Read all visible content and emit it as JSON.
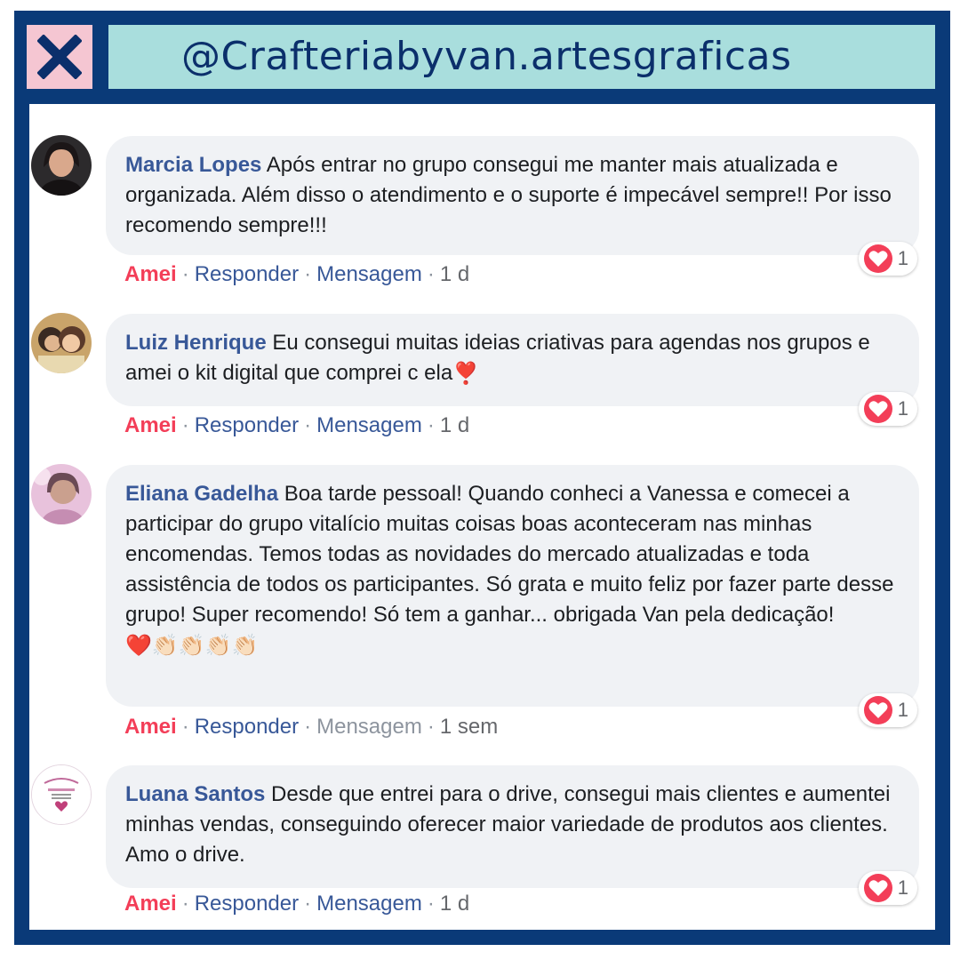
{
  "header": {
    "handle": "@Crafteriabyvan.artesgraficas",
    "close_icon": "close-x-icon",
    "colors": {
      "frame": "#0a3a78",
      "handle_bg": "#a9dedd",
      "close_bg": "#f5c6d2",
      "text": "#0b2f6b"
    }
  },
  "comments": [
    {
      "author": "Marcia Lopes",
      "text": "Após entrar no grupo consegui me manter mais atualizada e organizada. Além disso o atendimento e o suporte é impecável sempre!! Por isso recomendo sempre!!!",
      "actions": {
        "love": "Amei",
        "reply": "Responder",
        "message": "Mensagem",
        "time": "1 d"
      },
      "reaction_count": "1"
    },
    {
      "author": "Luiz Henrique",
      "text": "Eu consegui muitas ideias criativas para agendas nos grupos e amei o kit digital que comprei c ela",
      "emoji": "❣️",
      "actions": {
        "love": "Amei",
        "reply": "Responder",
        "message": "Mensagem",
        "time": "1 d"
      },
      "reaction_count": "1"
    },
    {
      "author": "Eliana Gadelha",
      "text": "Boa tarde pessoal! Quando conheci a Vanessa e comecei a participar do grupo vitalício muitas coisas boas aconteceram nas minhas encomendas. Temos todas as novidades do mercado atualizadas e toda assistência de todos os participantes. Só grata e muito feliz por fazer parte desse grupo! Super recomendo! Só tem a ganhar... obrigada Van pela dedicação!",
      "emoji": "❤️👏🏻👏🏻👏🏻👏🏻",
      "actions": {
        "love": "Amei",
        "reply": "Responder",
        "message": "Mensagem",
        "time": "1 sem"
      },
      "reaction_count": "1"
    },
    {
      "author": "Luana Santos",
      "text": "Desde que entrei para o drive, consegui mais clientes e aumentei minhas vendas, conseguindo oferecer maior variedade de produtos aos clientes. Amo o drive.",
      "actions": {
        "love": "Amei",
        "reply": "Responder",
        "message": "Mensagem",
        "time": "1 d"
      },
      "reaction_count": "1"
    }
  ]
}
